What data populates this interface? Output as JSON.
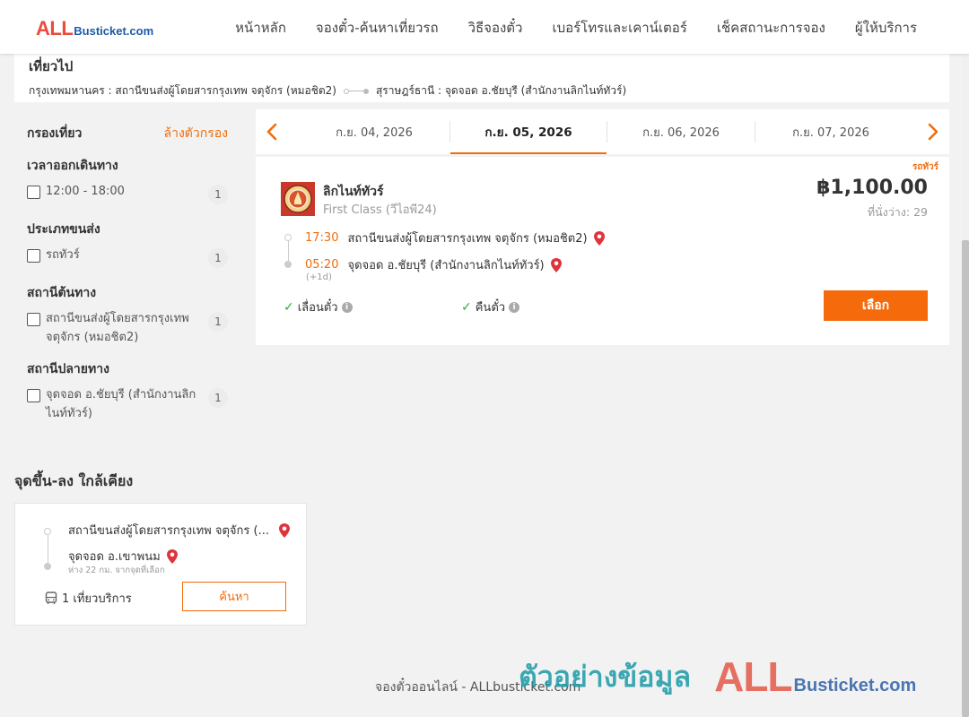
{
  "header": {
    "logo": {
      "all": "ALL",
      "rest": "Busticket.com"
    },
    "nav": [
      {
        "label": "หน้าหลัก"
      },
      {
        "label": "จองตั๋ว-ค้นหาเที่ยวรถ"
      },
      {
        "label": "วิธีจองตั๋ว"
      },
      {
        "label": "เบอร์โทรและเคาน์เตอร์"
      },
      {
        "label": "เช็คสถานะการจอง"
      },
      {
        "label": "ผู้ให้บริการ"
      }
    ]
  },
  "route": {
    "title": "เที่ยวไป",
    "origin": "กรุงเทพมหานคร : สถานีขนส่งผู้โดยสารกรุงเทพ จตุจักร (หมอชิต2)",
    "destination": "สุราษฎร์ธานี : จุดจอด อ.ชัยบุรี (สำนักงานลิกไนท์ทัวร์)"
  },
  "filter": {
    "title": "กรองเที่ยว",
    "clear": "ล้างตัวกรอง",
    "groups": [
      {
        "title": "เวลาออกเดินทาง",
        "options": [
          {
            "label": "12:00 - 18:00",
            "count": "1"
          }
        ]
      },
      {
        "title": "ประเภทขนส่ง",
        "options": [
          {
            "label": "รถทัวร์",
            "count": "1"
          }
        ]
      },
      {
        "title": "สถานีต้นทาง",
        "options": [
          {
            "label": "สถานีขนส่งผู้โดยสารกรุงเทพ จตุจักร (หมอชิต2)",
            "count": "1"
          }
        ]
      },
      {
        "title": "สถานีปลายทาง",
        "options": [
          {
            "label": "จุดจอด อ.ชัยบุรี (สำนักงานลิกไนท์ทัวร์)",
            "count": "1"
          }
        ]
      }
    ]
  },
  "dates": [
    {
      "label": "ก.ย. 04, 2026",
      "active": false
    },
    {
      "label": "ก.ย. 05, 2026",
      "active": true
    },
    {
      "label": "ก.ย. 06, 2026",
      "active": false
    },
    {
      "label": "ก.ย. 07, 2026",
      "active": false
    }
  ],
  "result": {
    "type_tag": "รถทัวร์",
    "operator": "ลิกไนท์ทัวร์",
    "class": "First Class (วีไอพี24)",
    "price": "฿1,100.00",
    "seats": "ที่นั่งว่าง: 29",
    "departure": {
      "time": "17:30",
      "station": "สถานีขนส่งผู้โดยสารกรุงเทพ จตุจักร (หมอชิต2)"
    },
    "arrival": {
      "time": "05:20",
      "station": "จุดจอด อ.ชัยบุรี (สำนักงานลิกไนท์ทัวร์)",
      "day_offset": "(+1d)"
    },
    "features": [
      "เลื่อนตั๋ว",
      "คืนตั๋ว"
    ],
    "select_label": "เลือก"
  },
  "nearby": {
    "title": "จุดขึ้น-ลง ใกล้เคียง",
    "origin": "สถานีขนส่งผู้โดยสารกรุงเทพ จตุจักร (...",
    "destination": "จุดจอด อ.เขาพนม",
    "distance_note": "ห่าง 22 กม. จากจุดที่เลือก",
    "trips": "1 เที่ยวบริการ",
    "search_label": "ค้นหา"
  },
  "footer": {
    "text": "จองตั๋วออนไลน์ - ALLbusticket.com",
    "watermark_thai": "ตัวอย่างข้อมูล",
    "watermark_all": "ALL",
    "watermark_rest": "Busticket.com"
  },
  "colors": {
    "accent": "#f56b0c",
    "brand_red": "#e84c3d",
    "brand_blue": "#1f5aa6",
    "check_green": "#2eaa3c",
    "pin_red": "#e0333c"
  }
}
